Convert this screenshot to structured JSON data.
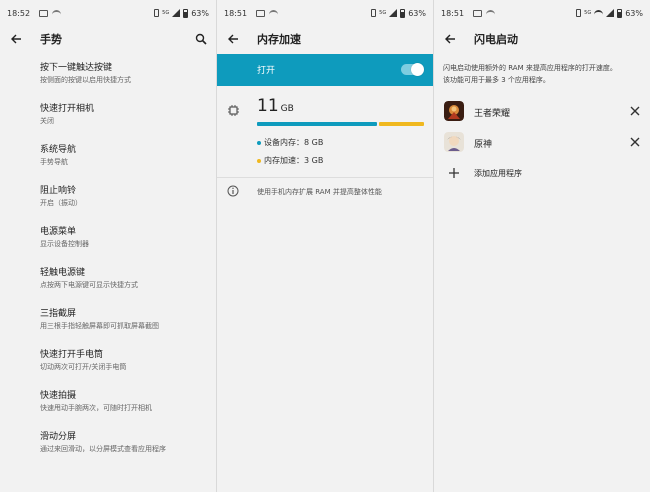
{
  "colors": {
    "accent": "#0e9bbd",
    "accel": "#f0b81f",
    "background": "#f2f2f2"
  },
  "panel1": {
    "status": {
      "time": "18:52",
      "battery": "63%",
      "network": "5G"
    },
    "title": "手势",
    "items": [
      {
        "title": "按下一键触达按键",
        "subtitle": "按侧面的按键以启用快捷方式"
      },
      {
        "title": "快速打开相机",
        "subtitle": "关闭"
      },
      {
        "title": "系统导航",
        "subtitle": "手势导航"
      },
      {
        "title": "阻止响铃",
        "subtitle": "开启（振动）"
      },
      {
        "title": "电源菜单",
        "subtitle": "显示设备控制器"
      },
      {
        "title": "轻触电源键",
        "subtitle": "点按两下电源键可显示快捷方式"
      },
      {
        "title": "三指截屏",
        "subtitle": "用三根手指轻触屏幕即可抓取屏幕截图"
      },
      {
        "title": "快速打开手电筒",
        "subtitle": "切动两次可打开/关闭手电筒"
      },
      {
        "title": "快速拍摄",
        "subtitle": "快速甩动手腕两次，可随时打开相机"
      },
      {
        "title": "滑动分屏",
        "subtitle": "通过来回滑动，以分屏模式查看应用程序"
      }
    ]
  },
  "panel2": {
    "status": {
      "time": "18:51",
      "battery": "63%",
      "network": "5G"
    },
    "title": "内存加速",
    "toggle_label": "打开",
    "toggle_on": true,
    "total_value": "11",
    "total_unit": "GB",
    "device_fraction": 0.727,
    "legend": [
      {
        "label": "设备内存：8 GB",
        "color": "#0e9bbd"
      },
      {
        "label": "内存加速：3 GB",
        "color": "#f0b81f"
      }
    ],
    "info": "使用手机内存扩展 RAM 并提高整体性能"
  },
  "panel3": {
    "status": {
      "time": "18:51",
      "battery": "63%",
      "network": "5G"
    },
    "title": "闪电启动",
    "description_line1": "闪电启动使用额外的 RAM 来提高应用程序的打开速度。",
    "description_line2": "该功能可用于最多 3 个应用程序。",
    "apps": [
      {
        "name": "王者荣耀",
        "icon": "game-icon-honor-of-kings"
      },
      {
        "name": "原神",
        "icon": "game-icon-genshin"
      }
    ],
    "add_label": "添加应用程序"
  }
}
